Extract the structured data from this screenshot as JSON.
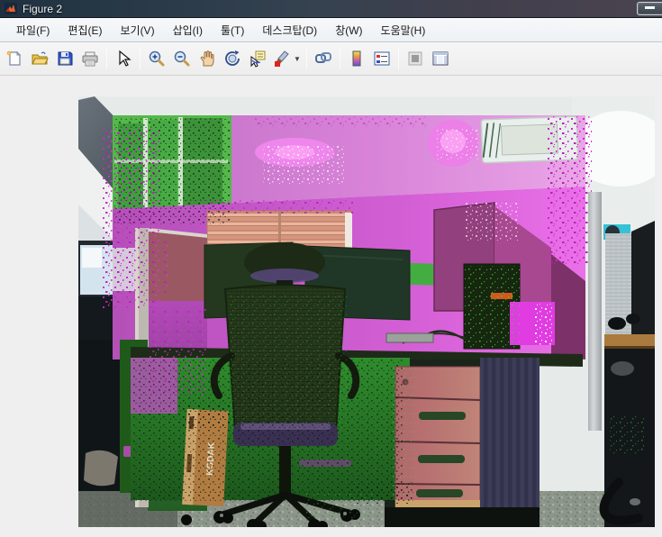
{
  "window": {
    "title": "Figure 2",
    "app_icon": "matlab-logo-icon",
    "controls": {
      "minimize": "minimize-button"
    }
  },
  "menu": {
    "items": [
      "파일(F)",
      "편집(E)",
      "보기(V)",
      "삽입(I)",
      "툴(T)",
      "데스크탑(D)",
      "창(W)",
      "도움말(H)"
    ]
  },
  "toolbar": {
    "buttons": [
      "new-figure",
      "open-file",
      "save-figure",
      "print-figure",
      "edit-plot-arrow",
      "zoom-in",
      "zoom-out",
      "pan-hand",
      "rotate-3d",
      "data-cursor",
      "brush-data",
      "link-plot",
      "insert-colorbar",
      "insert-legend",
      "hide-plot-tools",
      "show-plot-tools"
    ]
  },
  "figure": {
    "kodak_label": "KODAK",
    "description": "Office cubicle webcam photo with false-color processing: magenta ceiling and walls, green furniture and window, dark office chair in center, salmon drawer cabinet, speckled dither noise at region boundaries",
    "colors": {
      "overlay_magenta": "#c85cc8",
      "overlay_bright_magenta": "#e83ce8",
      "overlay_green": "#2f8c2d",
      "ceiling_white": "#e6ebe9",
      "floor_gray": "#8d968b",
      "drawer_salmon": "#b5696e",
      "kodak_box_tan": "#b07c42",
      "chair_dark": "#26391c",
      "seat_purple": "#58487c",
      "cyan_object": "#37c1d6",
      "wood_shelf": "#ab7a3e"
    }
  }
}
